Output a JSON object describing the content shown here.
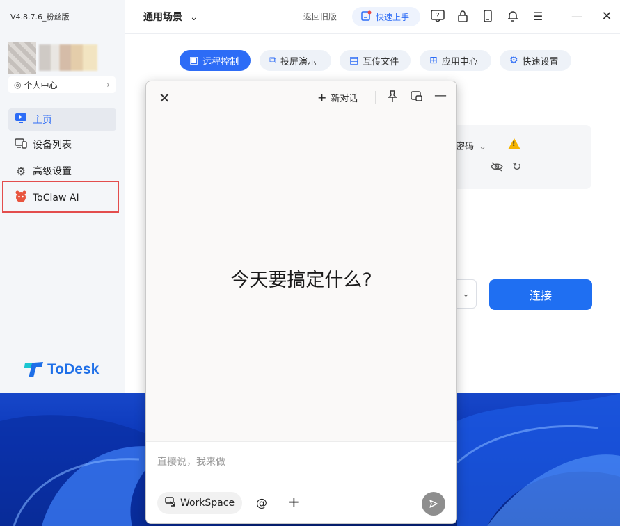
{
  "app": {
    "version": "V4.8.7.6_粉丝版",
    "personal_center": "个人中心",
    "nav": [
      {
        "label": "主页",
        "icon": "home-monitor-icon"
      },
      {
        "label": "设备列表",
        "icon": "devices-icon"
      },
      {
        "label": "高级设置",
        "icon": "gear-icon"
      },
      {
        "label": "ToClaw AI",
        "icon": "toclaw-mascot-icon"
      }
    ],
    "brand": "ToDesk"
  },
  "topbar": {
    "scene": "通用场景",
    "back_old": "返回旧版",
    "quick_start": "快速上手"
  },
  "tabs": [
    {
      "label": "远程控制",
      "active": true
    },
    {
      "label": "投屏演示",
      "active": false
    },
    {
      "label": "互传文件",
      "active": false
    },
    {
      "label": "应用中心",
      "active": false
    },
    {
      "label": "快速设置",
      "active": false
    }
  ],
  "main": {
    "password_label": "密码",
    "connect": "连接"
  },
  "chat": {
    "new_chat": "新对话",
    "headline": "今天要搞定什么?",
    "placeholder": "直接说，我来做",
    "workspace": "WorkSpace",
    "at": "@"
  },
  "colors": {
    "accent": "#2d6cf6",
    "highlight_border": "#e34d4d",
    "warning": "#f5b400"
  }
}
